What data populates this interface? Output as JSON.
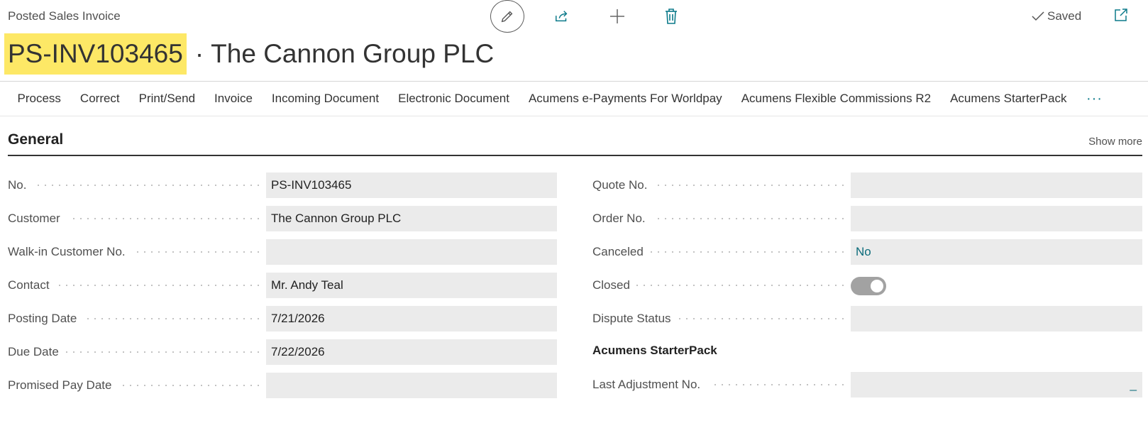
{
  "header": {
    "page_type": "Posted Sales Invoice",
    "saved_label": "Saved",
    "title_no": "PS-INV103465",
    "title_separator": "·",
    "title_name": "The Cannon Group PLC"
  },
  "actions": [
    "Process",
    "Correct",
    "Print/Send",
    "Invoice",
    "Incoming Document",
    "Electronic Document",
    "Acumens e-Payments For Worldpay",
    "Acumens Flexible Commissions R2",
    "Acumens StarterPack"
  ],
  "more_label": "···",
  "section": {
    "title": "General",
    "show_more": "Show more"
  },
  "left_fields": [
    {
      "label": "No.",
      "value": "PS-INV103465"
    },
    {
      "label": "Customer",
      "value": "The Cannon Group PLC"
    },
    {
      "label": "Walk-in Customer No.",
      "value": ""
    },
    {
      "label": "Contact",
      "value": "Mr. Andy Teal"
    },
    {
      "label": "Posting Date",
      "value": "7/21/2026"
    },
    {
      "label": "Due Date",
      "value": "7/22/2026"
    },
    {
      "label": "Promised Pay Date",
      "value": ""
    }
  ],
  "right_fields": {
    "quote_no": {
      "label": "Quote No.",
      "value": ""
    },
    "order_no": {
      "label": "Order No.",
      "value": ""
    },
    "canceled": {
      "label": "Canceled",
      "value": "No"
    },
    "closed": {
      "label": "Closed",
      "state": "off"
    },
    "dispute_status": {
      "label": "Dispute Status",
      "value": ""
    },
    "group_title": "Acumens StarterPack",
    "last_adjustment": {
      "label": "Last Adjustment No.",
      "value": "_"
    }
  },
  "colors": {
    "highlight": "#fde866",
    "accent": "#0b6b7a",
    "field_bg": "#ebebeb"
  },
  "icons": [
    "pencil-icon",
    "share-icon",
    "plus-icon",
    "trash-icon",
    "checkmark-icon",
    "popout-icon"
  ]
}
